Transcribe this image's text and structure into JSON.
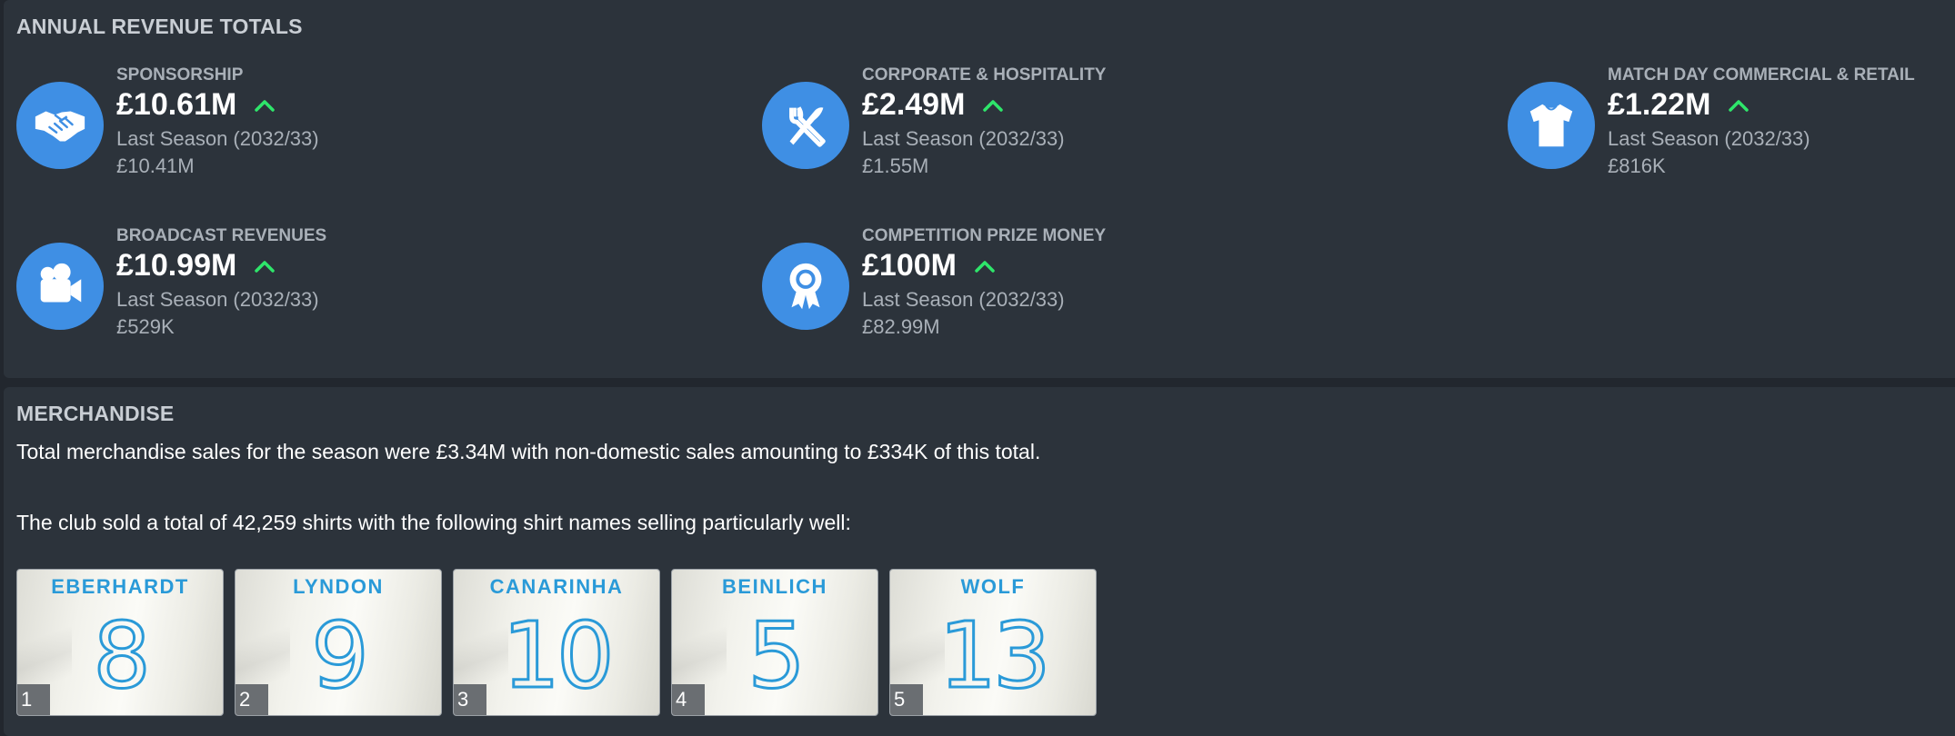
{
  "annual_revenue": {
    "title": "ANNUAL REVENUE TOTALS",
    "items": [
      {
        "label": "SPONSORSHIP",
        "value": "£10.61M",
        "prev_label": "Last Season (2032/33)",
        "prev_value": "£10.41M",
        "icon": "handshake-icon",
        "trend": "up"
      },
      {
        "label": "CORPORATE & HOSPITALITY",
        "value": "£2.49M",
        "prev_label": "Last Season (2032/33)",
        "prev_value": "£1.55M",
        "icon": "cutlery-icon",
        "trend": "up"
      },
      {
        "label": "MATCH DAY COMMERCIAL & RETAIL",
        "value": "£1.22M",
        "prev_label": "Last Season (2032/33)",
        "prev_value": "£816K",
        "icon": "shirt-icon",
        "trend": "up"
      },
      {
        "label": "BROADCAST REVENUES",
        "value": "£10.99M",
        "prev_label": "Last Season (2032/33)",
        "prev_value": "£529K",
        "icon": "video-camera-icon",
        "trend": "up"
      },
      {
        "label": "COMPETITION PRIZE MONEY",
        "value": "£100M",
        "prev_label": "Last Season (2032/33)",
        "prev_value": "£82.99M",
        "icon": "award-ribbon-icon",
        "trend": "up"
      }
    ]
  },
  "merchandise": {
    "title": "MERCHANDISE",
    "sales_text": "Total merchandise sales for the season were £3.34M with non-domestic sales amounting to £334K of this total.",
    "shirts_text": "The club sold a total of 42,259 shirts with the following shirt names selling particularly well:",
    "shirts": [
      {
        "name": "EBERHARDT",
        "number": "8",
        "rank": "1"
      },
      {
        "name": "LYNDON",
        "number": "9",
        "rank": "2"
      },
      {
        "name": "CANARINHA",
        "number": "10",
        "rank": "3"
      },
      {
        "name": "BEINLICH",
        "number": "5",
        "rank": "4"
      },
      {
        "name": "WOLF",
        "number": "13",
        "rank": "5"
      }
    ]
  },
  "colors": {
    "background": "#22272e",
    "panel": "#2c333b",
    "icon_circle": "#3f8fe4",
    "trend_up": "#2ee66b",
    "shirt_print": "#2a9ad8"
  }
}
